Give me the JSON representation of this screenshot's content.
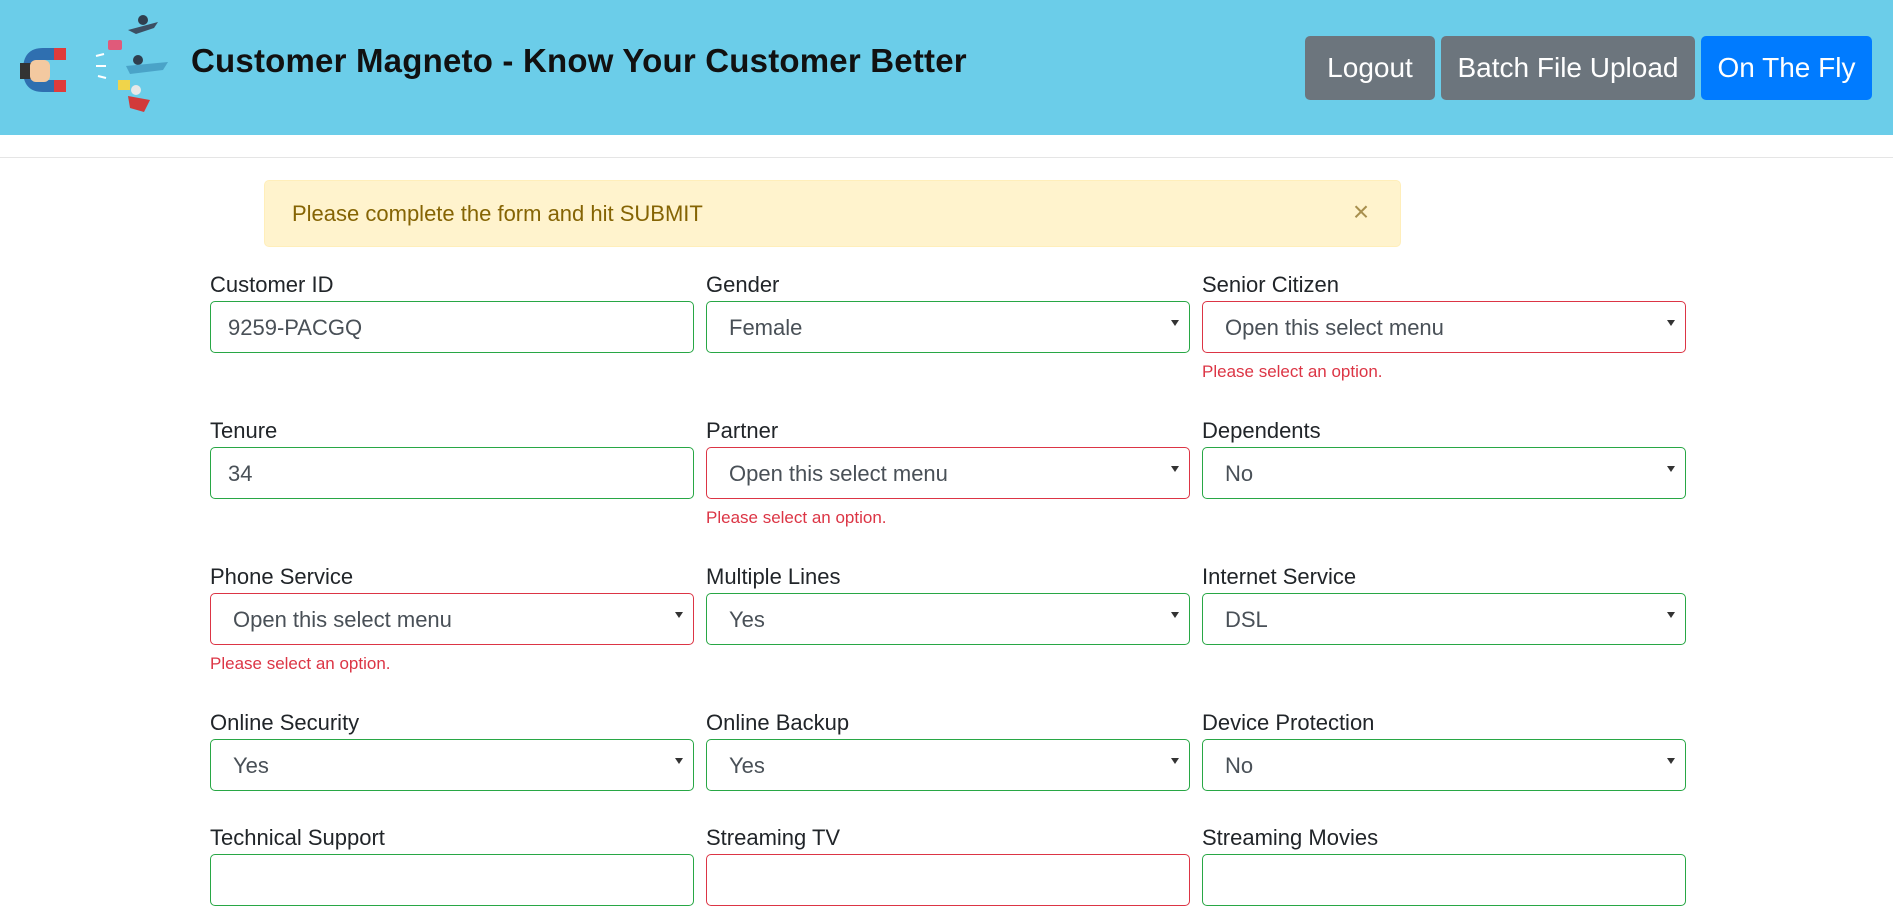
{
  "header": {
    "title": "Customer Magneto - Know Your Customer Better",
    "buttons": {
      "logout": "Logout",
      "batch_upload": "Batch File Upload",
      "on_the_fly": "On The Fly"
    },
    "colors": {
      "header_bg": "#6bcde9",
      "secondary": "#6c757d",
      "primary": "#007bff"
    }
  },
  "alert": {
    "message": "Please complete the form and hit SUBMIT",
    "close": "×"
  },
  "form": {
    "customer_id": {
      "label": "Customer ID",
      "value": "9259-PACGQ"
    },
    "gender": {
      "label": "Gender",
      "value": "Female"
    },
    "senior_citizen": {
      "label": "Senior Citizen",
      "value": "Open this select menu",
      "error": "Please select an option."
    },
    "tenure": {
      "label": "Tenure",
      "value": "34"
    },
    "partner": {
      "label": "Partner",
      "value": "Open this select menu",
      "error": "Please select an option."
    },
    "dependents": {
      "label": "Dependents",
      "value": "No"
    },
    "phone_service": {
      "label": "Phone Service",
      "value": "Open this select menu",
      "error": "Please select an option."
    },
    "multiple_lines": {
      "label": "Multiple Lines",
      "value": "Yes"
    },
    "internet_service": {
      "label": "Internet Service",
      "value": "DSL"
    },
    "online_security": {
      "label": "Online Security",
      "value": "Yes"
    },
    "online_backup": {
      "label": "Online Backup",
      "value": "Yes"
    },
    "device_protection": {
      "label": "Device Protection",
      "value": "No"
    },
    "technical_support": {
      "label": "Technical Support"
    },
    "streaming_tv": {
      "label": "Streaming TV"
    },
    "streaming_movies": {
      "label": "Streaming Movies"
    }
  }
}
